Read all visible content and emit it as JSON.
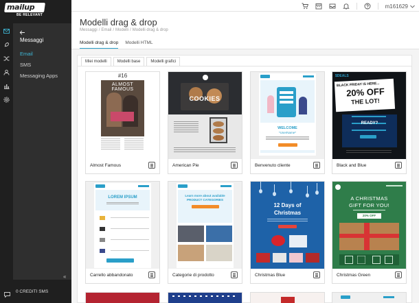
{
  "brand": {
    "logo_text": "mailup",
    "tagline": "BE RELEVANT"
  },
  "topbar": {
    "icons": [
      "cart-icon",
      "calendar-icon",
      "inbox-icon",
      "bell-icon",
      "help-icon"
    ],
    "user_label": "m161629"
  },
  "rail_icons": [
    "mail-icon",
    "rocket-icon",
    "shuffle-icon",
    "contacts-icon",
    "stats-icon",
    "settings-icon"
  ],
  "panel": {
    "title": "Messaggi",
    "items": [
      {
        "label": "Email",
        "active": true
      },
      {
        "label": "SMS",
        "active": false
      },
      {
        "label": "Messaging Apps",
        "active": false
      }
    ]
  },
  "footer": {
    "credits": "0 CREDITI SMS"
  },
  "page": {
    "title": "Modelli drag & drop",
    "breadcrumb": [
      "Messaggi",
      "Email",
      "Modelli",
      "Modelli drag & drop"
    ],
    "tabs": [
      {
        "label": "Modelli drag & drop",
        "active": true
      },
      {
        "label": "Modelli HTML",
        "active": false
      }
    ],
    "subtabs": [
      {
        "label": "Miei modelli",
        "active": false
      },
      {
        "label": "Modelli base",
        "active": false
      },
      {
        "label": "Modelli grafici",
        "active": true
      }
    ]
  },
  "templates": [
    {
      "name": "Almost Famous",
      "thumb_text": [
        "#16",
        "ALMOST FAMOUS"
      ]
    },
    {
      "name": "American Pie",
      "thumb_text": [
        "COOKIES"
      ]
    },
    {
      "name": "Benvenuto cliente",
      "thumb_text": [
        "WELCOME",
        "*UserName*"
      ]
    },
    {
      "name": "Black and Blue",
      "thumb_text": [
        "BLACK FRIDAY IS HERE...",
        "20% OFF",
        "THE LOT!",
        "READY?"
      ]
    },
    {
      "name": "Carrello abbandonato",
      "thumb_text": [
        "LOREM IPSUM"
      ]
    },
    {
      "name": "Categorie di prodotto",
      "thumb_text": [
        "Learn more about available",
        "PRODUCT CATEGORIES"
      ]
    },
    {
      "name": "Christmas Blue",
      "thumb_text": [
        "12 Days of",
        "Christmas"
      ]
    },
    {
      "name": "Christmas Green",
      "thumb_text": [
        "A CHRISTMAS",
        "GIFT FOR YOU!",
        "20% OFF"
      ]
    }
  ],
  "colors": {
    "accent": "#2a9fc9",
    "sidebar_dark": "#1f1f1f",
    "panel_dark": "#2f2f2f",
    "active_link": "#3fb7d6"
  }
}
